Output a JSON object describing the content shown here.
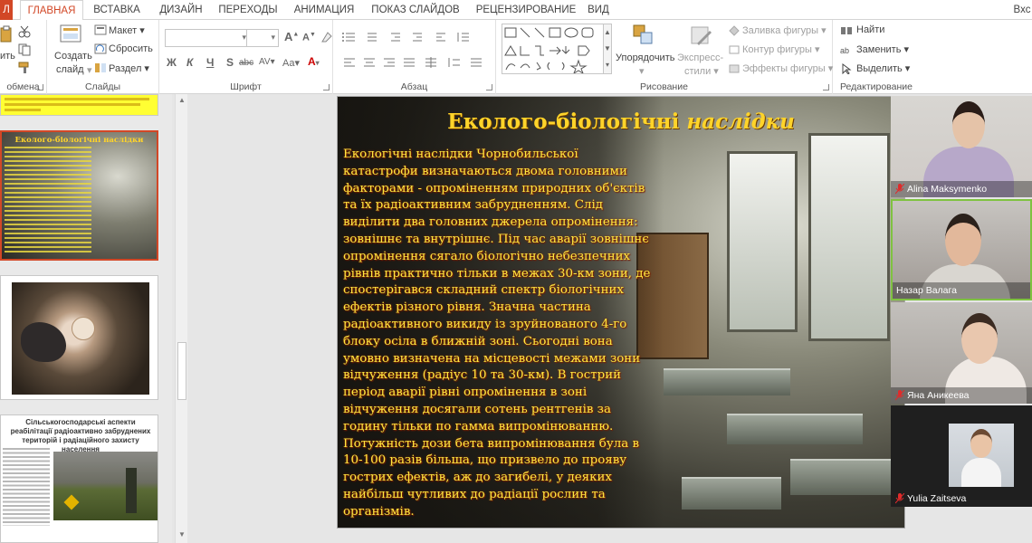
{
  "tabs": {
    "file": "Л",
    "items": [
      "ГЛАВНАЯ",
      "ВСТАВКА",
      "ДИЗАЙН",
      "ПЕРЕХОДЫ",
      "АНИМАЦИЯ",
      "ПОКАЗ СЛАЙДОВ",
      "РЕЦЕНЗИРОВАНИЕ",
      "ВИД"
    ],
    "active": "ГЛАВНАЯ",
    "signin": "Вхс"
  },
  "ribbon": {
    "groups": {
      "clipboard": "обмена",
      "slides": "Слайды",
      "font": "Шрифт",
      "paragraph": "Абзац",
      "drawing": "Рисование",
      "editing": "Редактирование"
    },
    "clipboard": {
      "paste": "ить"
    },
    "slides": {
      "new_slide_line1": "Создать",
      "new_slide_line2": "слайд",
      "layout": "Макет",
      "reset": "Сбросить",
      "section": "Раздел"
    },
    "font": {
      "bold": "Ж",
      "italic": "К",
      "underline": "Ч",
      "strike": "S",
      "strike_abc": "abc",
      "spacing": "AV",
      "case": "Aa",
      "grow": "A",
      "shrink": "A"
    },
    "drawing": {
      "arrange": "Упорядочить",
      "quick_styles_line1": "Экспресс-",
      "quick_styles_line2": "стили",
      "shape_fill": "Заливка фигуры",
      "shape_outline": "Контур фигуры",
      "shape_effects": "Эффекты фигуры"
    },
    "editing": {
      "find": "Найти",
      "replace": "Заменить",
      "select": "Выделить"
    }
  },
  "thumbnails": {
    "slide2_title": "Еколого-біологічні наслідки",
    "slide4_title": "Сільськогосподарські аспекти реабілітації радіоактивно забруднених територій і радіаційного захисту населення"
  },
  "slide": {
    "title_regular": "Еколого-біологічні ",
    "title_italic": "наслідки",
    "body": "Екологічні наслідки Чорнобильської катастрофи визначаються двома головними факторами - опроміненням природних об'єктів та їх радіоактивним забрудненням. Слід виділити два головних джерела опромінення: зовнішнє та внутрішнє. Під час аварії зовнішнє опромінення сягало біологічно небезпечних рівнів практично тільки в межах 30-км зони, де спостерігався складний спектр біологічних ефектів різного рівня. Значна частина радіоактивного викиду із зруйнованого 4-го блоку осіла в ближній зоні. Сьогодні вона умовно визначена на місцевості межами зони відчуження (радіус 10 та 30-км). В гострий період аварії рівні опромінення в зоні відчуження досягали сотень рентгенів за годину тільки по гамма випромінюванню. Потужність дози бета випромінювання була в 10-100 разів більша, що призвело до прояву гострих ефектів, аж до загибелі, у деяких найбільш чутливих до радіації рослин та організмів."
  },
  "participants": [
    {
      "name": "Alina Maksymenko"
    },
    {
      "name": "Назар Валага"
    },
    {
      "name": "Яна Аникеева"
    },
    {
      "name": "Yulia Zaitseva"
    }
  ],
  "colors": {
    "accent": "#d24726",
    "slide_text": "#ffe840",
    "title_text": "#ffd42a",
    "active_speaker": "#7fc241"
  }
}
